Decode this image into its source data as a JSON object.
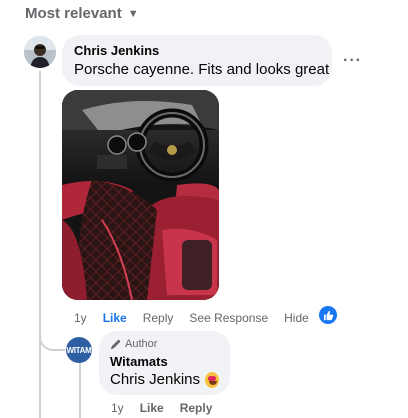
{
  "sort": {
    "label": "Most relevant",
    "caret_icon": "chevron-down-icon"
  },
  "comment": {
    "author": "Chris Jenkins",
    "text": "Porsche cayenne. Fits and looks great",
    "more_icon": "more-options-icon",
    "photo_alt": "Car interior with quilted floor mats",
    "actions": {
      "time": "1y",
      "like": "Like",
      "reply": "Reply",
      "see_response": "See Response",
      "hide": "Hide"
    },
    "reaction_icon": "like-reaction-icon"
  },
  "reply": {
    "badge": "Author",
    "author": "Witamats",
    "avatar_text": "WITAM",
    "text": "Chris Jenkins",
    "emoji_icon": "heart-eyes-emoji-icon",
    "actions": {
      "time": "1y",
      "like": "Like",
      "reply": "Reply"
    }
  },
  "colors": {
    "link_blue": "#1b74e4",
    "reaction_blue": "#1877f2",
    "bubble_bg": "#f0f2f5",
    "muted": "#65676b"
  }
}
